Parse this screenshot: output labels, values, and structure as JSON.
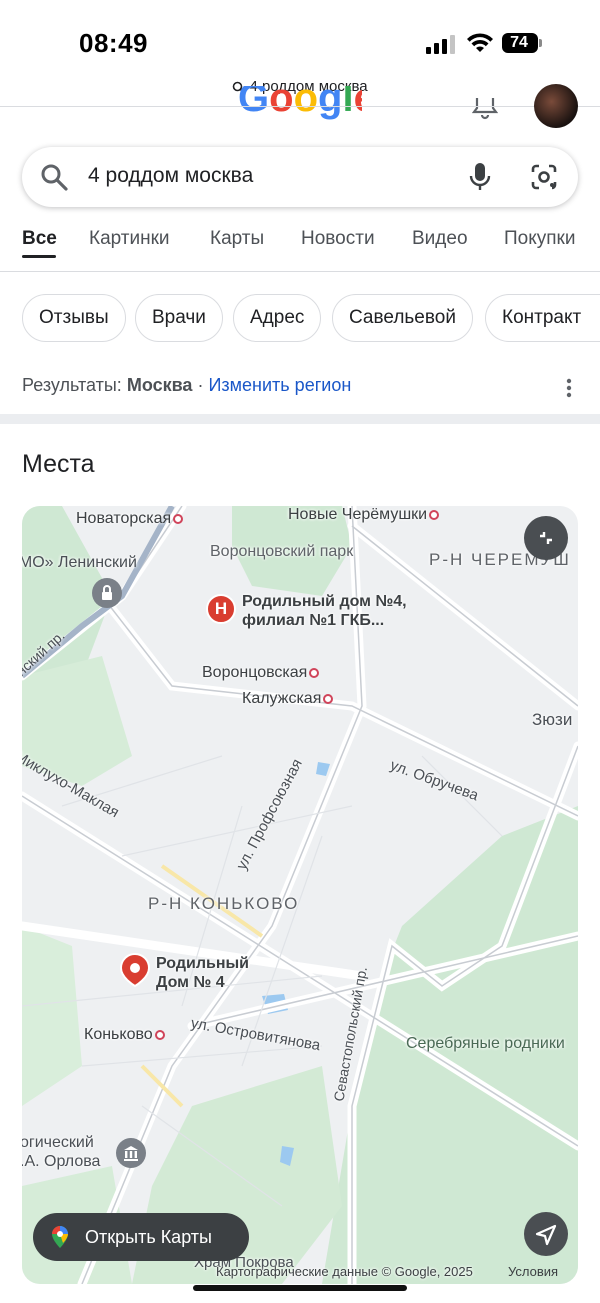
{
  "status": {
    "time": "08:49",
    "battery": "74"
  },
  "url": {
    "text": "4 роддом москва"
  },
  "search": {
    "query": "4 роддом москва"
  },
  "tabs": [
    "Все",
    "Картинки",
    "Карты",
    "Новости",
    "Видео",
    "Покупки"
  ],
  "chips": [
    "Отзывы",
    "Врачи",
    "Адрес",
    "Савельевой",
    "Контракт"
  ],
  "results": {
    "prefix": "Результаты:",
    "region": "Москва",
    "sep": "·",
    "change": "Изменить регион"
  },
  "places": {
    "title": "Места"
  },
  "map": {
    "labels": {
      "novatorskaya": "Новаторская",
      "novye_cheryomushki": "Новые Черёмушки",
      "vorontsovsky_park": "Воронцовский парк",
      "cheryomushki": "Р-Н ЧЕРЕМУШ",
      "leninsky": "«МО» Ленинский",
      "leninsky_pr": "Ленинский пр.",
      "vorontsovskaya": "Воронцовская",
      "kaluzhskaya": "Калужская",
      "zyuzi": "Зюзи",
      "miklukho": "Миклухо-Маклая",
      "obrucheva": "ул. Обручева",
      "profsoyuznaya": "ул. Профсоюзная",
      "konkovo_district": "Р-Н КОНЬКОВО",
      "konkovo": "Коньково",
      "ostrovityanova": "ул. Островитянова",
      "sevastopolsky": "Севастопольский пр.",
      "serebryanye": "Серебряные родники",
      "orlova_1": "огический",
      "orlova_2": ".А. Орлова",
      "pokrova": "Храм Покрова"
    },
    "pois": {
      "filial": "Родильный дом №4, филиал №1 ГКБ...",
      "main": "Родильный Дом № 4"
    },
    "open_maps": "Открыть Карты",
    "attribution": "Картографические данные © Google, 2025",
    "terms": "Условия"
  },
  "colors": {
    "accent": "#1a57c8",
    "pin": "#d93d30",
    "green": "#cfe8d3"
  }
}
